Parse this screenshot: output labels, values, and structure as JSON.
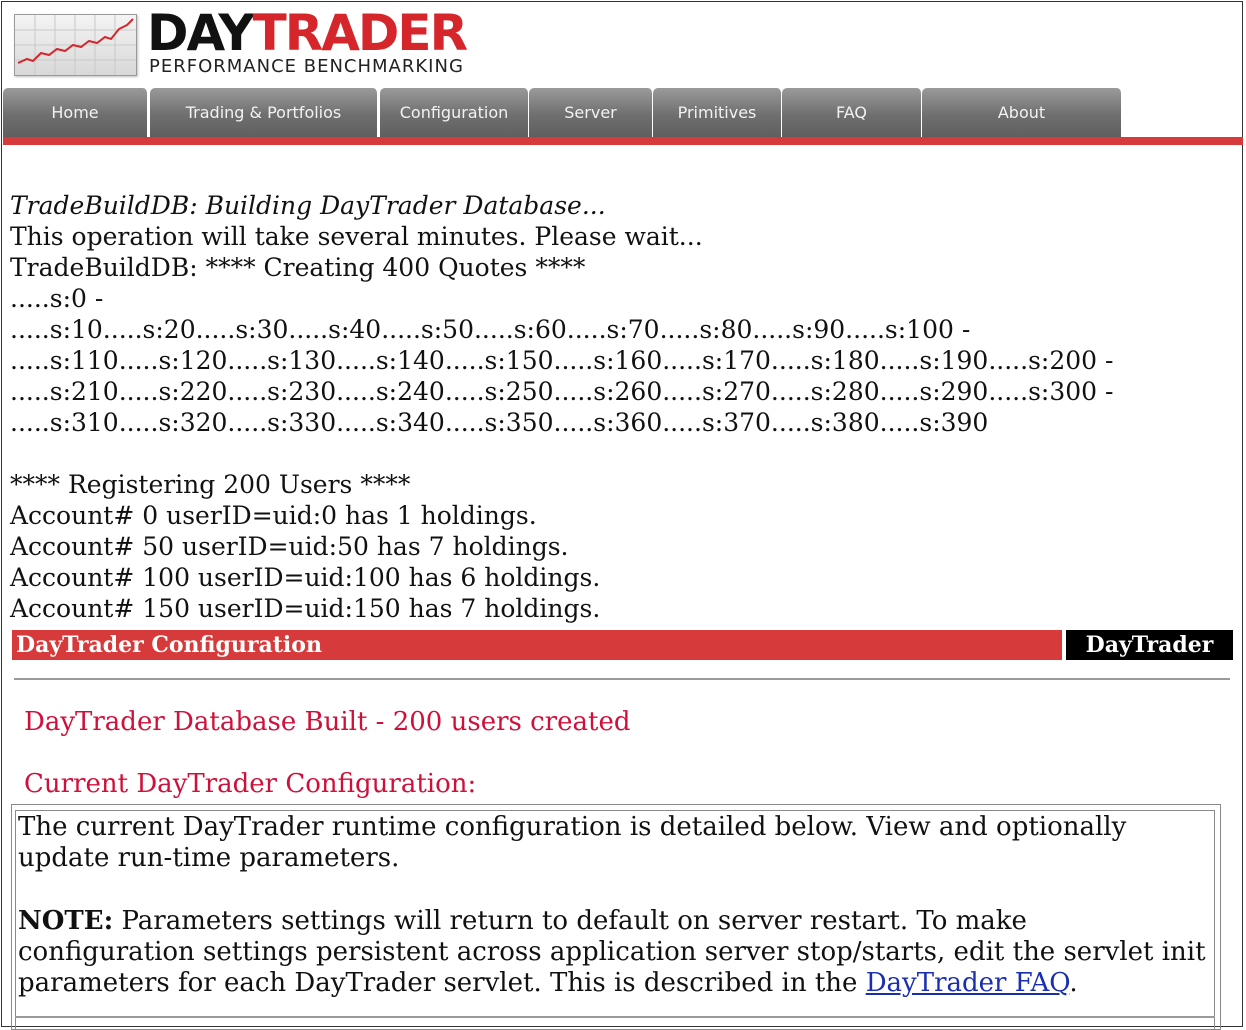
{
  "header": {
    "brand_day": "DAY",
    "brand_trader": "TRADER",
    "tagline": "PERFORMANCE BENCHMARKING"
  },
  "nav": {
    "tabs": [
      {
        "label": "Home"
      },
      {
        "label": "Trading & Portfolios"
      },
      {
        "label": "Configuration"
      },
      {
        "label": "Server"
      },
      {
        "label": "Primitives"
      },
      {
        "label": "FAQ"
      },
      {
        "label": "About"
      }
    ]
  },
  "log": {
    "lines": [
      "TradeBuildDB: Building DayTrader Database...",
      "This operation will take several minutes. Please wait...",
      "TradeBuildDB: **** Creating 400 Quotes ****",
      ".....s:0 -",
      ".....s:10.....s:20.....s:30.....s:40.....s:50.....s:60.....s:70.....s:80.....s:90.....s:100 -",
      ".....s:110.....s:120.....s:130.....s:140.....s:150.....s:160.....s:170.....s:180.....s:190.....s:200 -",
      ".....s:210.....s:220.....s:230.....s:240.....s:250.....s:260.....s:270.....s:280.....s:290.....s:300 -",
      ".....s:310.....s:320.....s:330.....s:340.....s:350.....s:360.....s:370.....s:380.....s:390",
      "**** Registering 200 Users ****",
      "Account# 0 userID=uid:0 has 1 holdings.",
      "Account# 50 userID=uid:50 has 7 holdings.",
      "Account# 100 userID=uid:100 has 6 holdings.",
      "Account# 150 userID=uid:150 has 7 holdings."
    ]
  },
  "config_bar": {
    "title": "DayTrader Configuration",
    "brand": "DayTrader"
  },
  "status": {
    "built_message": "DayTrader Database Built - 200 users created",
    "current_config_heading": "Current DayTrader Configuration:"
  },
  "info": {
    "intro": "The current DayTrader runtime configuration is detailed below. View and optionally update run-time parameters.",
    "note_label": "NOTE:",
    "note_text": " Parameters settings will return to default on server restart. To make configuration settings persistent across application server stop/starts, edit the servlet init parameters for each DayTrader servlet. This is described in the ",
    "faq_link": "DayTrader FAQ",
    "note_end": "."
  },
  "colors": {
    "accent_red": "#d63a3a",
    "message_red": "#d0103a",
    "link_blue": "#1a2fb0"
  }
}
